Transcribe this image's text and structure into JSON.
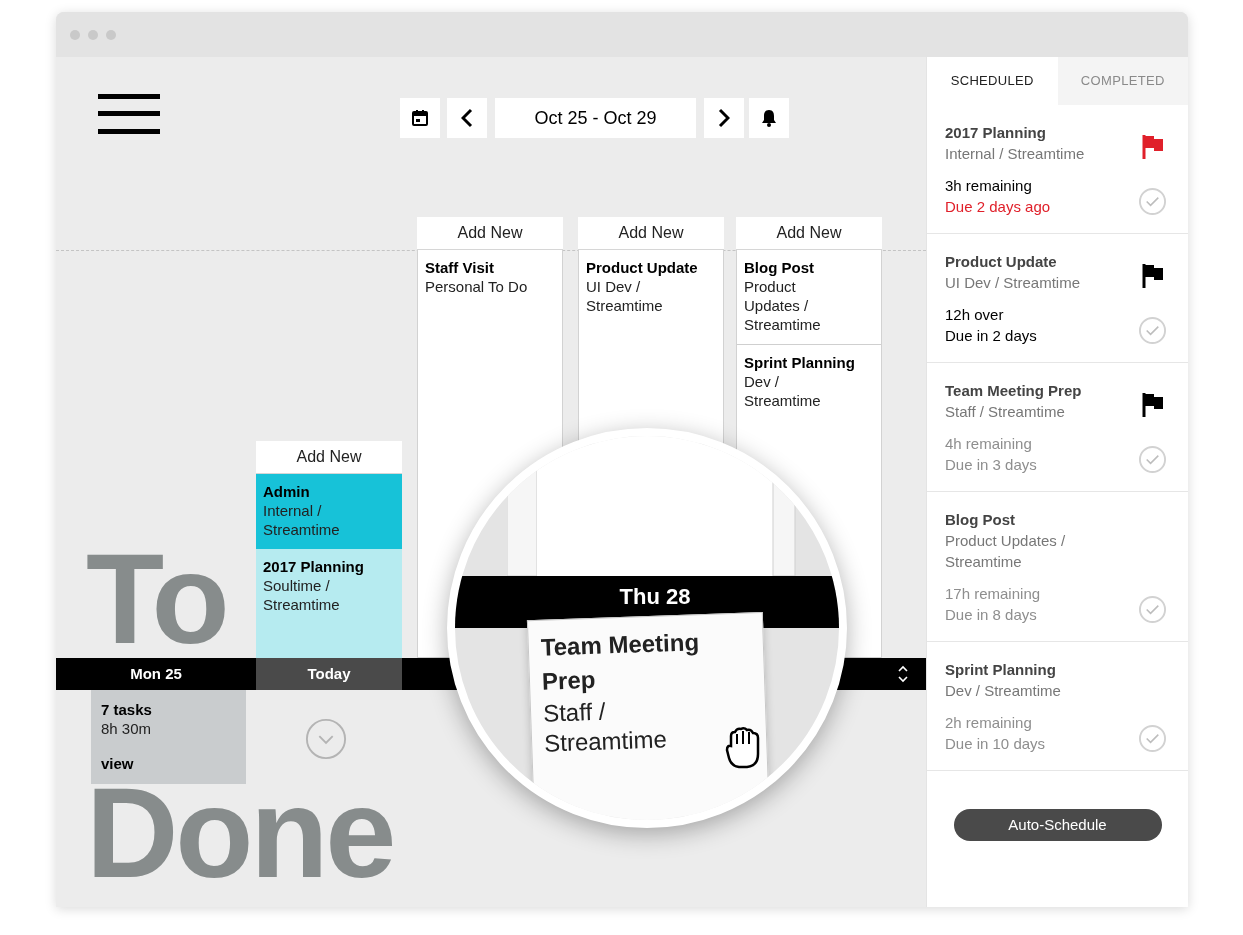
{
  "toolbar": {
    "date_range": "Oct 25 - Oct 29"
  },
  "headline": [
    "To",
    "Done"
  ],
  "columns": [
    {
      "add_label": "Add New",
      "cards": [
        {
          "title": "Admin",
          "subtitle": "Internal / Streamtime",
          "kind": "highlight"
        },
        {
          "title": "2017 Planning",
          "subtitle": "Soultime / Streamtime",
          "kind": "tinted"
        }
      ]
    },
    {
      "add_label": "Add New",
      "cards": [
        {
          "title": "Staff Visit",
          "subtitle": "Personal To Do",
          "kind": "plain"
        }
      ]
    },
    {
      "add_label": "Add New",
      "cards": [
        {
          "title": "Product Update",
          "subtitle": "UI Dev / Streamtime",
          "kind": "plain"
        }
      ]
    },
    {
      "add_label": "Add New",
      "cards": [
        {
          "title": "Blog Post",
          "subtitle": "Product Updates / Streamtime",
          "kind": "plain"
        },
        {
          "title": "Sprint Planning",
          "subtitle": "Dev / Streamtime",
          "kind": "plain"
        }
      ]
    }
  ],
  "day_strip": [
    {
      "label": "Mon 25",
      "selected": false
    },
    {
      "label": "Today",
      "selected": true
    }
  ],
  "summary": {
    "tasks": "7 tasks",
    "hours": "8h 30m",
    "link": "view"
  },
  "magnifier": {
    "day": "Thu 28",
    "card": {
      "title": "Team Meeting Prep",
      "subtitle": "Staff / Streamtime"
    }
  },
  "panel": {
    "tabs": [
      {
        "label": "SCHEDULED",
        "selected": true
      },
      {
        "label": "COMPLETED",
        "selected": false
      }
    ],
    "tasks": [
      {
        "title": "2017 Planning",
        "subtitle": "Internal / Streamtime",
        "hours": "3h remaining",
        "due": "Due 2 days ago",
        "kind": "overdue",
        "flag": true,
        "color": "#e0202a"
      },
      {
        "title": "Product Update",
        "subtitle": "UI Dev / Streamtime",
        "hours": "12h over",
        "due": "Due in 2 days",
        "kind": "soon",
        "flag": true,
        "color": "#000000"
      },
      {
        "title": "Team Meeting Prep",
        "subtitle": "Staff / Streamtime",
        "hours": "4h remaining",
        "due": "Due in 3 days",
        "kind": "later",
        "flag": true,
        "color": "#000000"
      },
      {
        "title": "Blog Post",
        "subtitle": "Product Updates / Streamtime",
        "hours": "17h remaining",
        "due": "Due in 8 days",
        "kind": "later",
        "flag": false
      },
      {
        "title": "Sprint Planning",
        "subtitle": "Dev / Streamtime",
        "hours": "2h remaining",
        "due": "Due in 10 days",
        "kind": "later",
        "flag": false
      }
    ],
    "button": "Auto-Schedule"
  }
}
